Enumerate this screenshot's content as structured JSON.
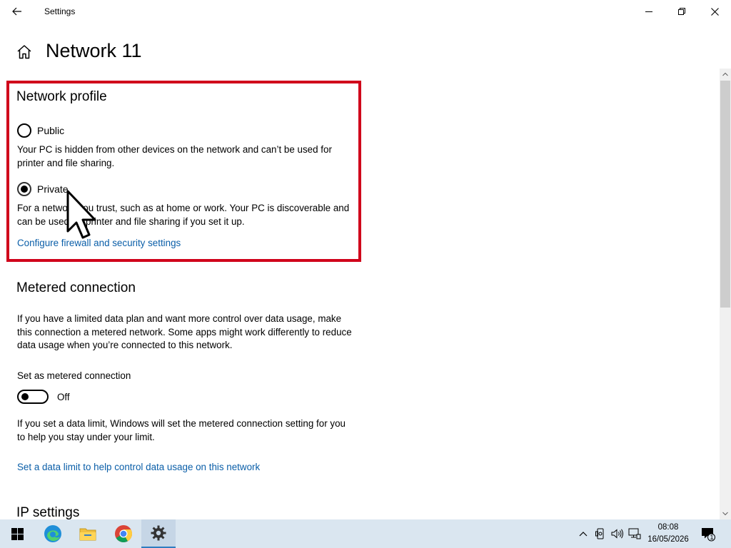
{
  "window": {
    "title": "Settings"
  },
  "page": {
    "title": "Network 11"
  },
  "network_profile": {
    "heading": "Network profile",
    "public_label": "Public",
    "public_desc": "Your PC is hidden from other devices on the network and can’t be used for printer and file sharing.",
    "private_label": "Private",
    "private_desc": "For a network you trust, such as at home or work. Your PC is discoverable and can be used for printer and file sharing if you set it up.",
    "selected": "Private",
    "link": "Configure firewall and security settings"
  },
  "metered": {
    "heading": "Metered connection",
    "desc": "If you have a limited data plan and want more control over data usage, make this connection a metered network. Some apps might work differently to reduce data usage when you’re connected to this network.",
    "toggle_label": "Set as metered connection",
    "toggle_state": "Off",
    "limit_desc": "If you set a data limit, Windows will set the metered connection setting for you to help you stay under your limit.",
    "limit_link": "Set a data limit to help control data usage on this network"
  },
  "ip_settings": {
    "heading": "IP settings"
  },
  "taskbar": {
    "time": "08:08",
    "date": "16/05/2026",
    "notification_count": "1"
  },
  "colors": {
    "highlight": "#d0021b",
    "link": "#0a5ea8",
    "taskbar": "#dae6f0"
  }
}
